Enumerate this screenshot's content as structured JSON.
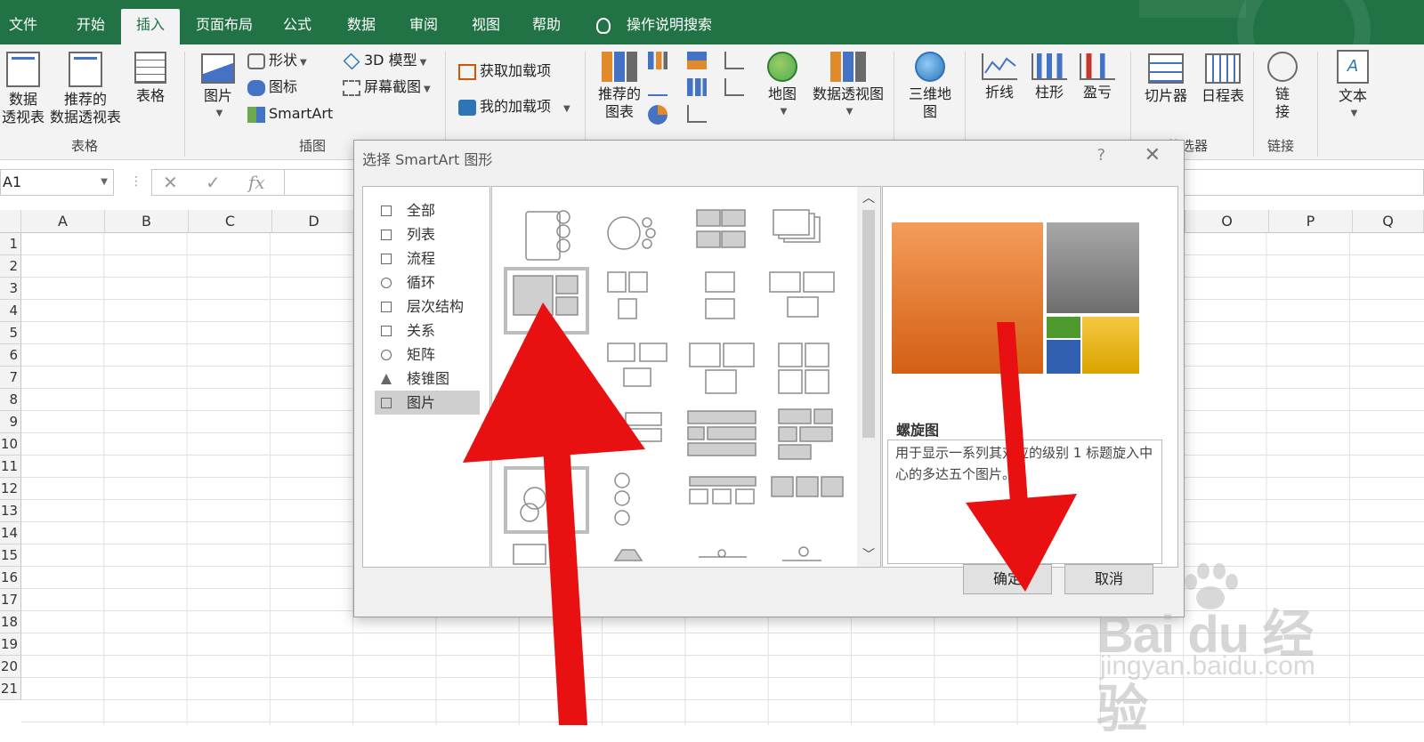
{
  "tabs": [
    {
      "label": "文件",
      "active": false
    },
    {
      "label": "开始",
      "active": false
    },
    {
      "label": "插入",
      "active": true
    },
    {
      "label": "页面布局",
      "active": false
    },
    {
      "label": "公式",
      "active": false
    },
    {
      "label": "数据",
      "active": false
    },
    {
      "label": "审阅",
      "active": false
    },
    {
      "label": "视图",
      "active": false
    },
    {
      "label": "帮助",
      "active": false
    }
  ],
  "tell_me": "操作说明搜索",
  "ribbon": {
    "tables": {
      "group_label": "表格",
      "pivot_line1": "数据",
      "pivot_line2": "透视表",
      "recommended_line1": "推荐的",
      "recommended_line2": "数据透视表",
      "table": "表格"
    },
    "illustrations": {
      "group_label": "插图",
      "pictures": "图片",
      "shapes": "形状",
      "icons": "图标",
      "smartart": "SmartArt",
      "model3d": "3D 模型",
      "screenshot": "屏幕截图"
    },
    "addins": {
      "get_addins": "获取加载项",
      "my_addins": "我的加载项"
    },
    "charts": {
      "recommended_line1": "推荐的",
      "recommended_line2": "图表",
      "maps": "地图",
      "pivot_chart": "数据透视图"
    },
    "tours": {
      "map3d_line1": "三维地",
      "map3d_line2": "图"
    },
    "sparklines": {
      "line": "折线",
      "column": "柱形",
      "winloss": "盈亏"
    },
    "filters": {
      "group_label": "筛选器",
      "slicer": "切片器",
      "timeline": "日程表"
    },
    "links": {
      "group_label": "链接",
      "link_line1": "链",
      "link_line2": "接"
    },
    "text": {
      "label": "文本"
    }
  },
  "formula_bar": {
    "name_box": "A1",
    "cancel": "✕",
    "enter": "✓",
    "fx": "fx"
  },
  "columns": [
    "A",
    "B",
    "C",
    "D",
    "O",
    "P",
    "Q"
  ],
  "rows": [
    "1",
    "2",
    "3",
    "4",
    "5",
    "6",
    "7",
    "8",
    "9",
    "10",
    "11",
    "12",
    "13",
    "14",
    "15",
    "16",
    "17",
    "18",
    "19",
    "20",
    "21"
  ],
  "dialog": {
    "title": "选择 SmartArt 图形",
    "help": "?",
    "close": "✕",
    "categories": [
      {
        "label": "全部",
        "selected": false
      },
      {
        "label": "列表",
        "selected": false
      },
      {
        "label": "流程",
        "selected": false
      },
      {
        "label": "循环",
        "selected": false
      },
      {
        "label": "层次结构",
        "selected": false
      },
      {
        "label": "关系",
        "selected": false
      },
      {
        "label": "矩阵",
        "selected": false
      },
      {
        "label": "棱锥图",
        "selected": false
      },
      {
        "label": "图片",
        "selected": true
      }
    ],
    "preview_name": "螺旋图",
    "preview_desc": "用于显示一系列其对应的级别 1 标题旋入中心的多达五个图片。",
    "ok": "确定",
    "cancel": "取消"
  },
  "watermark": {
    "brand": "Bai du 经验",
    "url": "jingyan.baidu.com"
  },
  "colors": {
    "excel_green": "#217346",
    "arrow_red": "#e81010",
    "preview_orange": "#e8742c",
    "preview_gray": "#8a8a8a",
    "preview_green": "#4e9a2f",
    "preview_blue": "#3260b0",
    "preview_yellow": "#e8b800"
  }
}
